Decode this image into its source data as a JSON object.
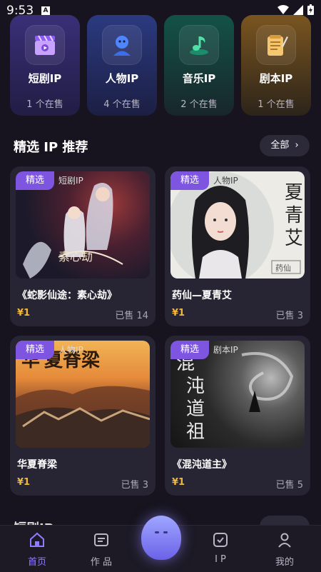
{
  "status_bar": {
    "time": "9:53",
    "notif_icon": "A"
  },
  "categories": [
    {
      "name": "短剧IP",
      "count": "1 个在售",
      "icon": "clapperboard-icon"
    },
    {
      "name": "人物IP",
      "count": "4 个在售",
      "icon": "person-icon"
    },
    {
      "name": "音乐IP",
      "count": "2 个在售",
      "icon": "music-note-icon"
    },
    {
      "name": "剧本IP",
      "count": "1 个在售",
      "icon": "script-icon"
    }
  ],
  "featured": {
    "title": "精选 IP 推荐",
    "all_label": "全部"
  },
  "products": [
    {
      "badge": "精选",
      "type": "短剧IP",
      "title": "《蛇影仙途：素心劫》",
      "price": "¥1",
      "sold": "已售 14"
    },
    {
      "badge": "精选",
      "type": "人物IP",
      "title": "药仙—夏青艾",
      "price": "¥1",
      "sold": "已售 3"
    },
    {
      "badge": "精选",
      "type": "人物IP",
      "title": "华夏脊梁",
      "price": "¥1",
      "sold": "已售 3"
    },
    {
      "badge": "精选",
      "type": "剧本IP",
      "title": "《混沌道主》",
      "price": "¥1",
      "sold": "已售 5"
    }
  ],
  "next_section": {
    "title": "短剧IP"
  },
  "nav": {
    "home": "首页",
    "works": "作 品",
    "ip": "I P",
    "mine": "我的"
  },
  "colors": {
    "accent": "#8f7dff",
    "price": "#f0b83a",
    "badge": "#7d55e0"
  }
}
